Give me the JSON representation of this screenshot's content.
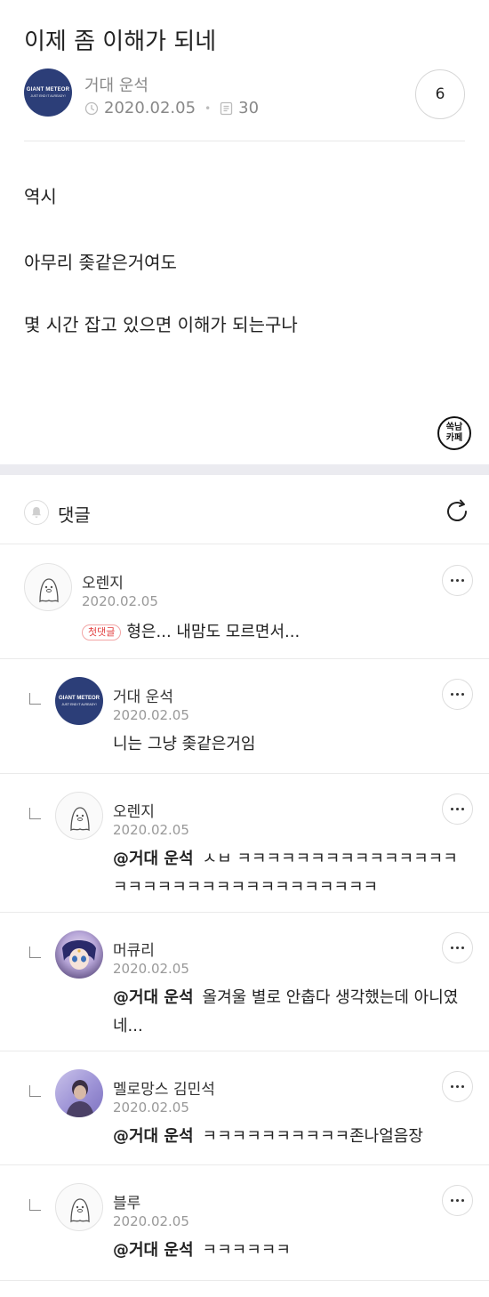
{
  "post": {
    "title": "이제 좀 이해가 되네",
    "author": "거대 운석",
    "author_avatar_text1": "GIANT METEOR",
    "author_avatar_text2": "JUST END IT ALREADY!",
    "date": "2020.02.05",
    "views": "30",
    "comment_count": "6",
    "body": [
      "역시",
      "아무리 좆같은거여도",
      "몇 시간 잡고 있으면 이해가 되는구나"
    ],
    "stamp": [
      "쏙남",
      "카페"
    ]
  },
  "comments_section": {
    "label": "댓글"
  },
  "comments": [
    {
      "name": "오렌지",
      "date": "2020.02.05",
      "badge": "첫댓글",
      "mention": "",
      "text": "형은... 내맘도 모르면서...",
      "reply": false
    },
    {
      "name": "거대 운석",
      "date": "2020.02.05",
      "badge": "",
      "mention": "",
      "text": "니는 그냥 좆같은거임",
      "reply": true
    },
    {
      "name": "오렌지",
      "date": "2020.02.05",
      "badge": "",
      "mention": "@거대 운석",
      "text": "ㅅㅂ ㅋㅋㅋㅋㅋㅋㅋㅋㅋㅋㅋㅋㅋㅋㅋㅋㅋㅋㅋㅋㅋㅋㅋㅋㅋㅋㅋㅋㅋㅋㅋㅋㅋ",
      "reply": true
    },
    {
      "name": "머큐리",
      "date": "2020.02.05",
      "badge": "",
      "mention": "@거대 운석",
      "text": "올겨울 별로 안춥다 생각했는데 아니였네...",
      "reply": true
    },
    {
      "name": "멜로망스 김민석",
      "date": "2020.02.05",
      "badge": "",
      "mention": "@거대 운석",
      "text": "ㅋㅋㅋㅋㅋㅋㅋㅋㅋㅋ존나얼음장",
      "reply": true
    },
    {
      "name": "블루",
      "date": "2020.02.05",
      "badge": "",
      "mention": "@거대 운석",
      "text": "ㅋㅋㅋㅋㅋㅋ",
      "reply": true
    }
  ],
  "icons": [
    "clock-icon",
    "document-icon",
    "bell-icon",
    "refresh-icon",
    "more-icon",
    "reply-arrow-icon"
  ]
}
